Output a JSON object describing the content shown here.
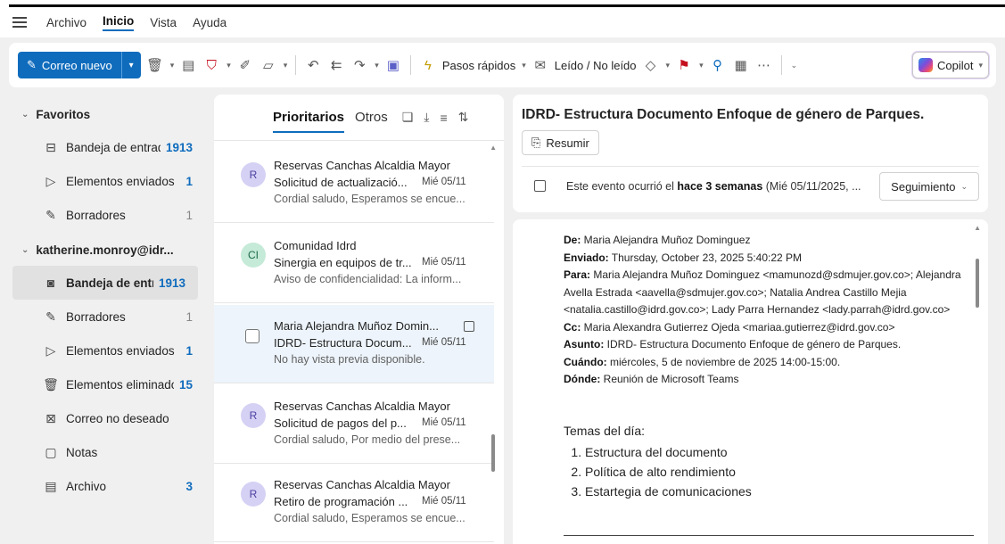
{
  "menu": {
    "items": [
      "Archivo",
      "Inicio",
      "Vista",
      "Ayuda"
    ],
    "active": "Inicio"
  },
  "ribbon": {
    "new_mail": "Correo nuevo",
    "quick_steps": "Pasos rápidos",
    "read_unread": "Leído / No leído",
    "copilot": "Copilot"
  },
  "folders": {
    "favorites_title": "Favoritos",
    "favorites": [
      {
        "label": "Bandeja de entrada",
        "count": "1913"
      },
      {
        "label": "Elementos enviados",
        "count": "1"
      },
      {
        "label": "Borradores",
        "count": "1"
      }
    ],
    "account_title": "katherine.monroy@idr...",
    "account": [
      {
        "label": "Bandeja de entra...",
        "count": "1913"
      },
      {
        "label": "Borradores",
        "count": "1"
      },
      {
        "label": "Elementos enviados",
        "count": "1"
      },
      {
        "label": "Elementos eliminados",
        "count": "15"
      },
      {
        "label": "Correo no deseado",
        "count": ""
      },
      {
        "label": "Notas",
        "count": ""
      },
      {
        "label": "Archivo",
        "count": "3"
      }
    ]
  },
  "message_list": {
    "tab_focused": "Prioritarios",
    "tab_other": "Otros",
    "messages": [
      {
        "avatar": "R",
        "from": "Reservas Canchas Alcaldia Mayor",
        "subject": "Solicitud de actualizació...",
        "date": "Mié 05/11",
        "preview": "Cordial saludo, Esperamos se encue..."
      },
      {
        "avatar": "CI",
        "from": "Comunidad Idrd",
        "subject": "Sinergia en equipos de tr...",
        "date": "Mié 05/11",
        "preview": "Aviso de confidencialidad: La inform..."
      },
      {
        "avatar": "",
        "from": "Maria Alejandra Muñoz Domin...",
        "subject": "IDRD- Estructura Docum...",
        "date": "Mié 05/11",
        "preview": "No hay vista previa disponible."
      },
      {
        "avatar": "R",
        "from": "Reservas Canchas Alcaldia Mayor",
        "subject": "Solicitud de pagos del p...",
        "date": "Mié 05/11",
        "preview": "Cordial saludo, Por medio del prese..."
      },
      {
        "avatar": "R",
        "from": "Reservas Canchas Alcaldia Mayor",
        "subject": "Retiro de programación ...",
        "date": "Mié 05/11",
        "preview": "Cordial saludo, Esperamos se encue..."
      }
    ]
  },
  "reading": {
    "title": "IDRD- Estructura Documento Enfoque de género de Parques.",
    "summarize": "Resumir",
    "event_prefix": "Este evento ocurrió el ",
    "event_bold": "hace 3 semanas",
    "event_suffix": " (Mié 05/11/2025, ...",
    "follow_up": "Seguimiento",
    "header": {
      "from_label": "De:",
      "from": " Maria Alejandra Muñoz Dominguez",
      "sent_label": "Enviado:",
      "sent": " Thursday, October 23, 2025 5:40:22 PM",
      "to_label": "Para:",
      "to": " Maria Alejandra Muñoz Dominguez <mamunozd@sdmujer.gov.co>; Alejandra Avella Estrada <aavella@sdmujer.gov.co>; Natalia Andrea Castillo Mejia <natalia.castillo@idrd.gov.co>; Lady Parra Hernandez <lady.parrah@idrd.gov.co>",
      "cc_label": "Cc:",
      "cc": " Maria Alexandra Gutierrez Ojeda <mariaa.gutierrez@idrd.gov.co>",
      "subject_label": "Asunto:",
      "subject": " IDRD- Estructura Documento Enfoque de género de Parques.",
      "when_label": "Cuándo:",
      "when": " miércoles, 5 de noviembre de 2025 14:00-15:00.",
      "where_label": "Dónde:",
      "where": " Reunión de Microsoft Teams"
    },
    "agenda_title": "Temas del día:",
    "agenda": [
      "Estructura del documento",
      "Política de alto rendimiento",
      "Estartegia de comunicaciones"
    ]
  }
}
